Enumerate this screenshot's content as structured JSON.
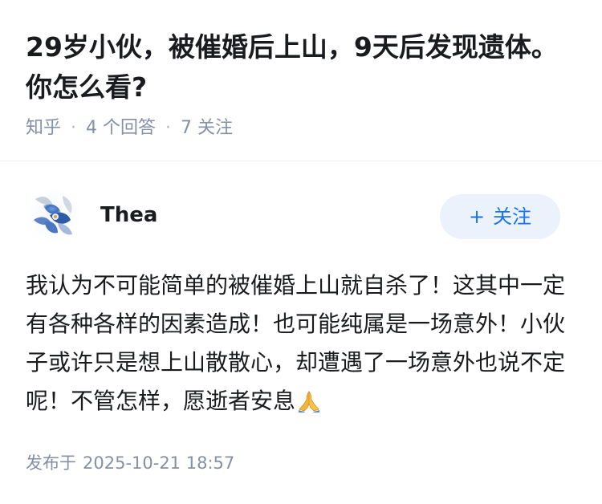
{
  "question": {
    "title": "29岁小伙，被催婚后上山，9天后发现遗体。你怎么看?",
    "source": "知乎",
    "answers_count": "4 个回答",
    "followers_count": "7 关注"
  },
  "answer": {
    "author": {
      "name": "Thea",
      "avatar_icon": "blue-flower-avatar"
    },
    "follow_button": {
      "plus": "+",
      "label": "关注"
    },
    "content": "我认为不可能简单的被催婚上山就自杀了！这其中一定有各种各样的因素造成！也可能纯属是一场意外！小伙子或许只是想上山散散心，却遭遇了一场意外也说不定呢！不管怎样，愿逝者安息",
    "emoji_icon": "folded-hands-icon",
    "published_label": "发布于",
    "published_time": "2025-10-21 18:57"
  },
  "colors": {
    "title": "#191b1f",
    "meta": "#8590a6",
    "accent": "#1772f6",
    "follow_bg": "#ebf2fb"
  }
}
